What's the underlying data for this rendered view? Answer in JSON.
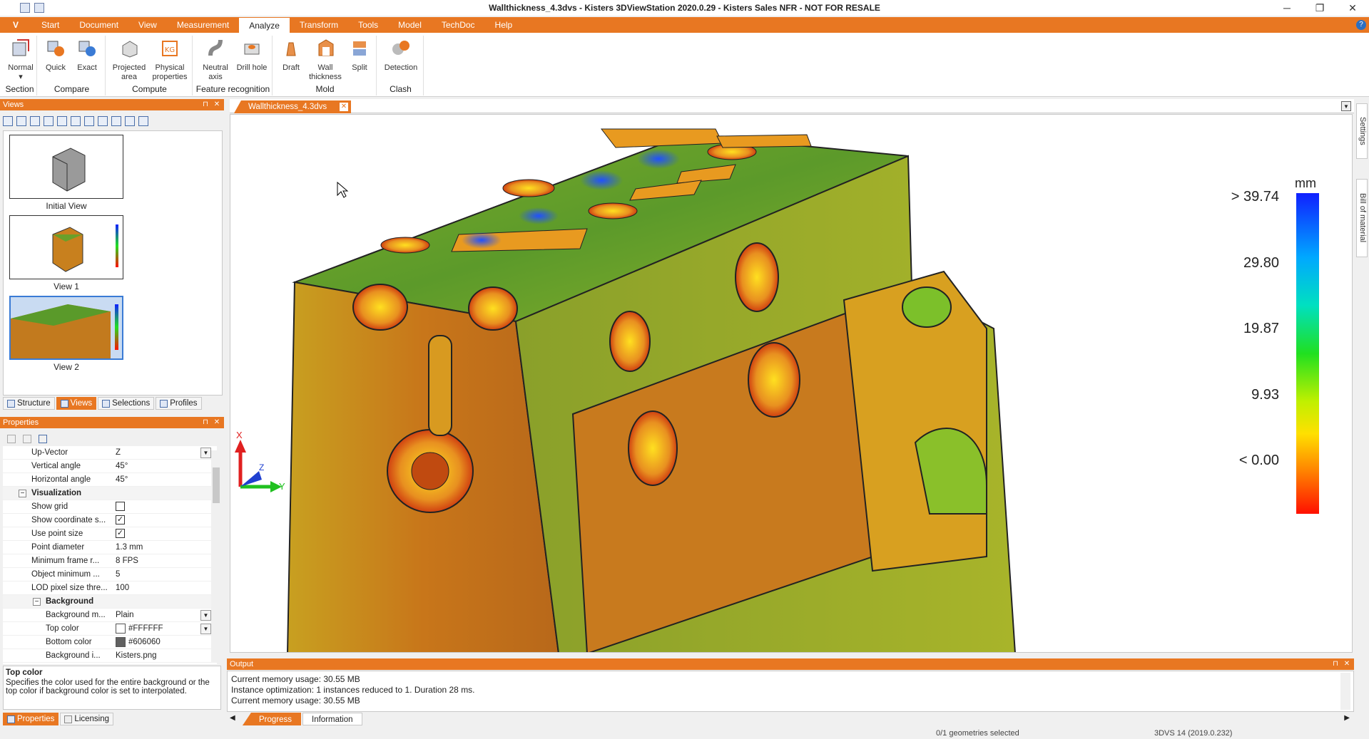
{
  "window": {
    "title": "Wallthickness_4.3dvs - Kisters 3DViewStation 2020.0.29 - Kisters Sales NFR - NOT FOR RESALE",
    "minimize": "─",
    "restore": "❐",
    "close": "✕"
  },
  "app_button": "V",
  "tabs": [
    "Start",
    "Document",
    "View",
    "Measurement",
    "Analyze",
    "Transform",
    "Tools",
    "Model",
    "TechDoc",
    "Help"
  ],
  "active_tab": "Analyze",
  "help_icon": "?",
  "ribbon": {
    "groups": [
      {
        "name": "Section",
        "buttons": [
          "Normal"
        ]
      },
      {
        "name": "Compare",
        "buttons": [
          "Quick",
          "Exact"
        ]
      },
      {
        "name": "Compute",
        "buttons": [
          "Projected area",
          "Physical properties"
        ]
      },
      {
        "name": "Feature recognition",
        "buttons": [
          "Neutral axis",
          "Drill hole"
        ]
      },
      {
        "name": "Mold",
        "buttons": [
          "Draft",
          "Wall thickness",
          "Split"
        ]
      },
      {
        "name": "Clash",
        "buttons": [
          "Detection"
        ]
      }
    ]
  },
  "views_panel": {
    "title": "Views",
    "items": [
      "Initial View",
      "View 1",
      "View 2"
    ],
    "tabs": [
      "Structure",
      "Views",
      "Selections",
      "Profiles"
    ],
    "active_tab": "Views"
  },
  "properties_panel": {
    "title": "Properties",
    "rows": [
      {
        "key": "Up-Vector",
        "value": "Z"
      },
      {
        "key": "Vertical angle",
        "value": "45°"
      },
      {
        "key": "Horizontal angle",
        "value": "45°"
      },
      {
        "key": "Visualization",
        "value": ""
      },
      {
        "key": "Show grid",
        "value": ""
      },
      {
        "key": "Show coordinate s...",
        "value": "✓"
      },
      {
        "key": "Use point size",
        "value": "✓"
      },
      {
        "key": "Point diameter",
        "value": "1.3 mm"
      },
      {
        "key": "Minimum frame r...",
        "value": "8 FPS"
      },
      {
        "key": "Object minimum ...",
        "value": "5"
      },
      {
        "key": "LOD pixel size thre...",
        "value": "100"
      },
      {
        "key": "Background",
        "value": ""
      },
      {
        "key": "Background m...",
        "value": "Plain"
      },
      {
        "key": "Top color",
        "value": "#FFFFFF"
      },
      {
        "key": "Bottom color",
        "value": "#606060"
      },
      {
        "key": "Background i...",
        "value": "Kisters.png"
      }
    ],
    "description_title": "Top color",
    "description": "Specifies the color used for the entire background or the top color if background color is set to interpolated.",
    "tabs": [
      "Properties",
      "Licensing"
    ]
  },
  "document_tab": "Wallthickness_4.3dvs",
  "legend": {
    "unit": "mm",
    "labels": [
      "> 39.74",
      "29.80",
      "19.87",
      "9.93",
      "< 0.00"
    ]
  },
  "axes": {
    "x": "X",
    "y": "Y",
    "z": "Z"
  },
  "side_tabs": [
    "Settings",
    "Bill of material"
  ],
  "output": {
    "title": "Output",
    "lines": [
      "Current memory usage: 30.55 MB",
      "Instance optimization: 1 instances reduced to 1. Duration 28 ms.",
      "Current memory usage: 30.55 MB"
    ],
    "tabs": [
      "Progress",
      "Information"
    ]
  },
  "status": {
    "selection": "0/1 geometries selected",
    "version": "3DVS 14 (2019.0.232)"
  },
  "colors": {
    "accent": "#e87722"
  }
}
